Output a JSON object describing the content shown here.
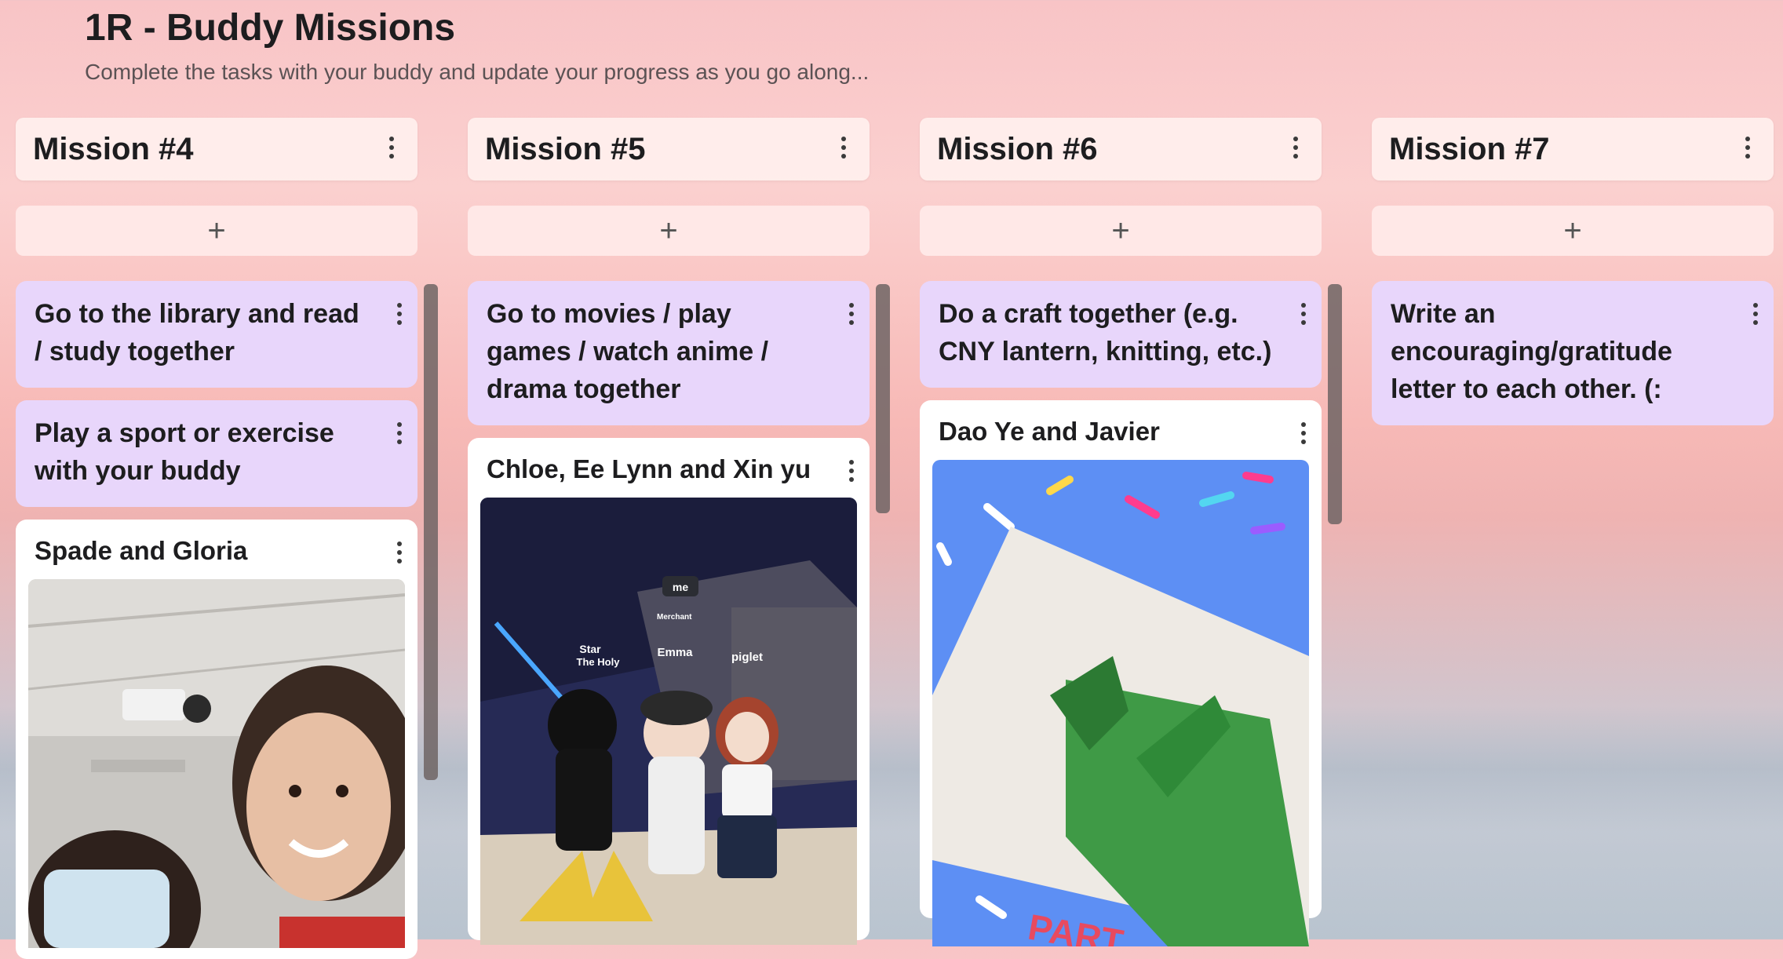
{
  "board": {
    "title": "1R - Buddy Missions",
    "subtitle": "Complete the tasks with your buddy and update your progress as you go along..."
  },
  "add_symbol": "+",
  "columns": [
    {
      "title": "Mission #4",
      "cards": [
        {
          "text": "Go to the library and read / study together"
        },
        {
          "text": "Play a sport or exercise with your buddy"
        },
        {
          "text": "Spade and Gloria",
          "image": "selfie-photo"
        }
      ]
    },
    {
      "title": "Mission #5",
      "cards": [
        {
          "text": "Go to movies / play games / watch anime / drama together"
        },
        {
          "text": "Chloe, Ee Lynn and Xin yu",
          "image": "game-screenshot"
        }
      ]
    },
    {
      "title": "Mission #6",
      "cards": [
        {
          "text": "Do a craft together (e.g. CNY lantern, knitting, etc.)"
        },
        {
          "text": "Dao Ye and Javier",
          "image": "origami-cranes-photo"
        }
      ]
    },
    {
      "title": "Mission #7",
      "cards": [
        {
          "text": "Write an encouraging/gratitude letter to each other. (:"
        }
      ]
    }
  ],
  "game_overlay": {
    "me": "me",
    "merchant": "Merchant",
    "p1": "Star",
    "p1_sub": "The Holy",
    "p2": "Emma",
    "p3": "piglet"
  },
  "colors": {
    "card_purple": "#e8d6fb",
    "card_white": "#ffffff",
    "column_header": "#fff0ee",
    "text": "#1d1d1f"
  }
}
